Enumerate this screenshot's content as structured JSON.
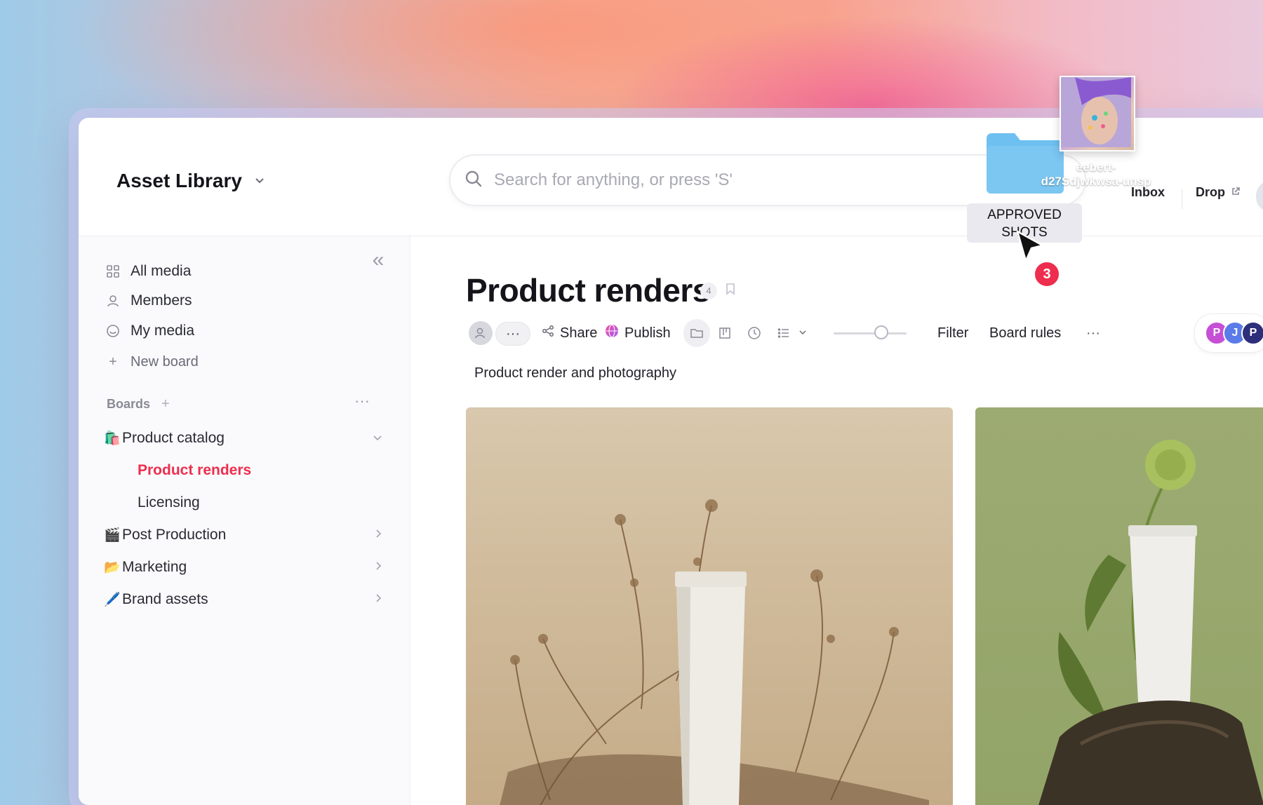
{
  "app": {
    "title": "Asset Library"
  },
  "search": {
    "placeholder": "Search for anything, or press 'S'"
  },
  "header": {
    "inbox_label": "Inbox",
    "drop_label": "Drop"
  },
  "sidebar": {
    "nav": [
      {
        "label": "All media",
        "icon": "grid-icon"
      },
      {
        "label": "Members",
        "icon": "person-icon"
      },
      {
        "label": "My media",
        "icon": "smiley-icon"
      }
    ],
    "new_board_label": "New board",
    "boards_label": "Boards",
    "boards": [
      {
        "label": "Product catalog",
        "emoji": "🛍️",
        "expanded": true,
        "children": [
          {
            "label": "Product renders",
            "active": true
          },
          {
            "label": "Licensing",
            "active": false
          }
        ]
      },
      {
        "label": "Post Production",
        "emoji": "🎬",
        "expanded": false
      },
      {
        "label": "Marketing",
        "emoji": "📂",
        "expanded": false
      },
      {
        "label": "Brand assets",
        "emoji": "🖊️",
        "expanded": false
      }
    ]
  },
  "main": {
    "title": "Product renders",
    "count": "4",
    "description": "Product render and photography",
    "toolbar": {
      "more": "···",
      "share_label": "Share",
      "publish_label": "Publish",
      "filter_label": "Filter",
      "board_rules_label": "Board rules",
      "overflow": "···",
      "size_slider_value": 0.65
    },
    "collaborators": [
      "P",
      "J",
      "P"
    ]
  },
  "drag": {
    "file_name": "eebert-d27sdjwkwsa-unsp",
    "file_name_line1": "eebert-",
    "file_name_line2": "d27Sdjwkwsa-unsp",
    "target_label_line1": "APPROVED",
    "target_label_line2": "SHOTS",
    "item_count": "3"
  },
  "colors": {
    "accent": "#ee2e4e",
    "folder": "#7cc6f2"
  }
}
